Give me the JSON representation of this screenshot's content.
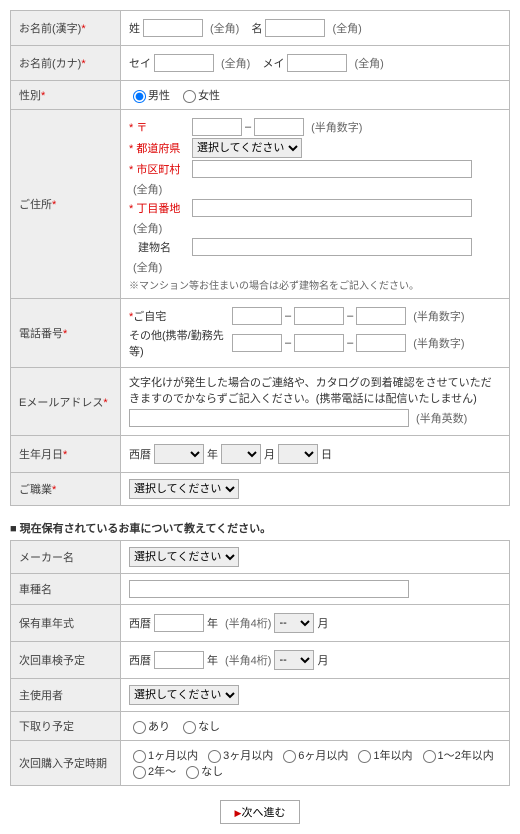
{
  "name_kanji": {
    "label": "お名前(漢字)",
    "sei": "姓",
    "mei": "名",
    "unit": "(全角)"
  },
  "name_kana": {
    "label": "お名前(カナ)",
    "sei": "セイ",
    "mei": "メイ",
    "unit": "(全角)"
  },
  "gender": {
    "label": "性別",
    "male": "男性",
    "female": "女性"
  },
  "address": {
    "label": "ご住所",
    "zip": "〒",
    "zip_unit": "(半角数字)",
    "pref": "都道府県",
    "pref_sel": "選択してください",
    "city": "市区町村",
    "unit": "(全角)",
    "street": "丁目番地",
    "bldg": "建物名",
    "note": "※マンション等お住まいの場合は必ず建物名をご記入ください。"
  },
  "phone": {
    "label": "電話番号",
    "home": "ご自宅",
    "home_unit": "(半角数字)",
    "other": "その他(携帯/勤務先等)",
    "other_unit": "(半角数字)"
  },
  "email": {
    "label": "Eメールアドレス",
    "note": "文字化けが発生した場合のご連絡や、カタログの到着確認をさせていただきますのでかならずご記入ください。(携帯電話には配信いたしません)",
    "unit": "(半角英数)"
  },
  "birth": {
    "label": "生年月日",
    "era": "西暦",
    "y": "年",
    "m": "月",
    "d": "日"
  },
  "job": {
    "label": "ご職業",
    "sel": "選択してください"
  },
  "section2": "現在保有されているお車について教えてください。",
  "car": {
    "maker": "メーカー名",
    "maker_sel": "選択してください",
    "type": "車種名",
    "year": "保有車年式",
    "era": "西暦",
    "y": "年",
    "y_unit": "(半角4桁)",
    "m": "月",
    "next_insp": "次回車検予定",
    "user": "主使用者",
    "user_sel": "選択してください",
    "trade": "下取り予定",
    "yes": "あり",
    "no": "なし",
    "plan": "次回購入予定時期",
    "opts": [
      "1ヶ月以内",
      "3ヶ月以内",
      "6ヶ月以内",
      "1年以内",
      "1～2年以内",
      "2年～",
      "なし"
    ]
  },
  "next_btn": "次へ進む"
}
